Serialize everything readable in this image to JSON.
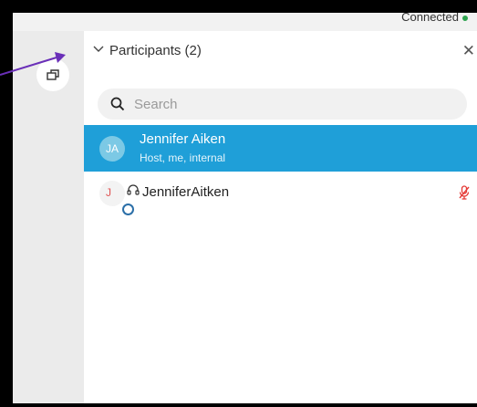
{
  "status": {
    "text": "Connected",
    "dot_color": "#2ea44f"
  },
  "panel": {
    "title": "Participants (2)"
  },
  "search": {
    "placeholder": "Search"
  },
  "participants": [
    {
      "initials": "JA",
      "name": "Jennifer Aiken",
      "subtitle": "Host, me, internal",
      "selected": true
    },
    {
      "initials": "J",
      "name": "JenniferAitken",
      "muted": true
    }
  ],
  "colors": {
    "selected_row": "#1f9fd8",
    "arrow": "#6a2fb8",
    "mute": "#e53935"
  },
  "icons": [
    "panel-toggle-icon",
    "chevron-down-icon",
    "close-icon",
    "search-icon",
    "presence-icon",
    "headset-icon",
    "muted-mic-icon",
    "annotation-arrow"
  ]
}
